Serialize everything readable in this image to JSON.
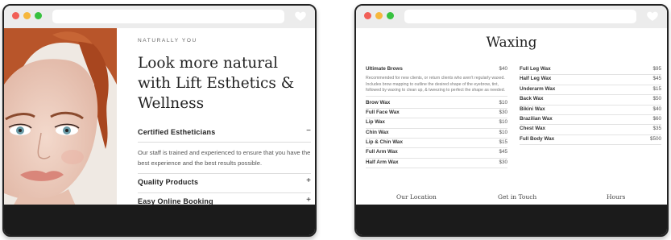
{
  "left_window": {
    "eyebrow": "NATURALLY YOU",
    "headline": "Look more natural with Lift Esthetics & Wellness",
    "accordion": [
      {
        "title": "Certified Estheticians",
        "sign": "−",
        "body": "Our staff is trained and experienced to ensure that you have the best experience and the best results possible."
      },
      {
        "title": "Quality Products",
        "sign": "+"
      },
      {
        "title": "Easy Online Booking",
        "sign": "+"
      }
    ]
  },
  "right_window": {
    "title": "Waxing",
    "first_service": {
      "name": "Ultimate Brows",
      "price": "$40",
      "description": "Recommended for new clients, or return clients who aren't regularly waxed. Includes brow mapping to outline the desired shape of the eyebrow, tint, followed by waxing to clean up, & tweezing to perfect the shape as needed."
    },
    "left_services": [
      {
        "name": "Brow Wax",
        "price": "$10"
      },
      {
        "name": "Full Face Wax",
        "price": "$30"
      },
      {
        "name": "Lip Wax",
        "price": "$10"
      },
      {
        "name": "Chin Wax",
        "price": "$10"
      },
      {
        "name": "Lip & Chin Wax",
        "price": "$15"
      },
      {
        "name": "Full Arm Wax",
        "price": "$45"
      },
      {
        "name": "Half Arm Wax",
        "price": "$30"
      }
    ],
    "right_services": [
      {
        "name": "Full Leg Wax",
        "price": "$95"
      },
      {
        "name": "Half Leg Wax",
        "price": "$45"
      },
      {
        "name": "Underarm Wax",
        "price": "$15"
      },
      {
        "name": "Back Wax",
        "price": "$50"
      },
      {
        "name": "Bikini Wax",
        "price": "$40"
      },
      {
        "name": "Brazilian Wax",
        "price": "$60"
      },
      {
        "name": "Chest Wax",
        "price": "$35"
      },
      {
        "name": "Full Body Wax",
        "price": "$500"
      }
    ],
    "footer_links": [
      "Our Location",
      "Get in Touch",
      "Hours"
    ]
  },
  "icons": {
    "close": "red-dot",
    "minimize": "yellow-dot",
    "maximize": "green-dot",
    "favorite": "heart-icon"
  },
  "colors": {
    "close": "#f15f57",
    "minimize": "#f6b73c",
    "maximize": "#37c13f",
    "footer_bar": "#1b1b1b"
  }
}
